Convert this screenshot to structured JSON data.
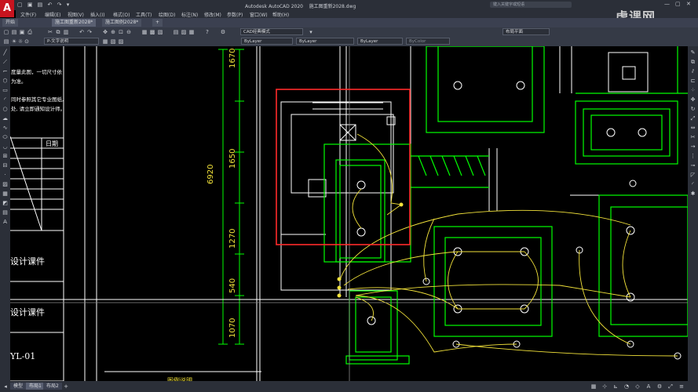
{
  "title_bar": {
    "app_name": "Autodesk AutoCAD 2020",
    "file_name": "施工图重新2028.dwg",
    "search_placeholder": "键入关键字或短语",
    "logo_letter": "A"
  },
  "menu": {
    "items": [
      "文件(F)",
      "编辑(E)",
      "视图(V)",
      "插入(I)",
      "格式(O)",
      "工具(T)",
      "绘图(D)",
      "标注(N)",
      "修改(M)",
      "参数(P)",
      "窗口(W)",
      "帮助(H)"
    ]
  },
  "watermark": "虎课网",
  "tabs": {
    "start_label": "开始",
    "docs": [
      "施工图重新2028*",
      "施工图例2028*"
    ],
    "add_label": "+"
  },
  "toolbar": {
    "workspace": "CAD经典模式",
    "layer_name": "P-文字说明",
    "color": "ByLayer",
    "linetype": "ByLayer",
    "lineweight": "ByLayer",
    "plotstyle": "ByColor",
    "layout_combo": "布局平面"
  },
  "status_bar": {
    "tabs": [
      "模型",
      "布局1",
      "布局2"
    ],
    "active": "布局1"
  },
  "drawing": {
    "notes": [
      "度量此图，一切尺寸依",
      "为准。",
      "同时参照其它专业图纸,",
      "处, 请立即通知设计师。"
    ],
    "date_header": "日期",
    "course_label_1": "设计课件",
    "course_label_2": "设计课件",
    "sheet_code": "YL-01",
    "bottom_title": "图例说明",
    "dimensions": [
      "1670",
      "1650",
      "6920",
      "1270",
      "540",
      "1070"
    ]
  },
  "colors": {
    "accent_red": "#c8141f",
    "dim_green": "#00ff00",
    "wire_yellow": "#f2e23a",
    "highlight_red": "#ff2a2a",
    "chrome": "#2b2f38"
  }
}
